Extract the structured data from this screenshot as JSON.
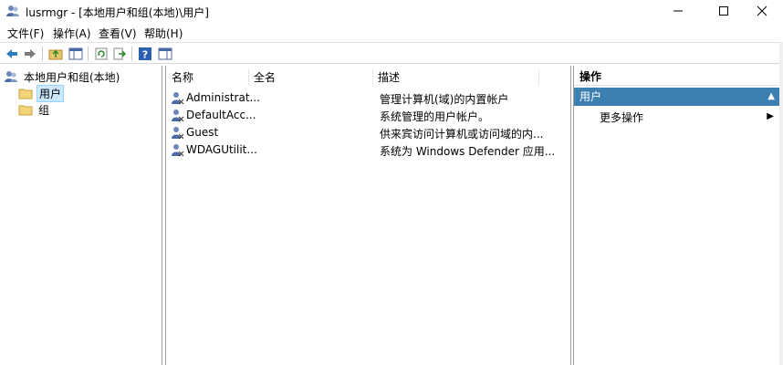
{
  "window": {
    "title": "lusrmgr - [本地用户和组(本地)\\用户]",
    "app_icon": "users-icon"
  },
  "menu": [
    {
      "label": "文件(F)"
    },
    {
      "label": "操作(A)"
    },
    {
      "label": "查看(V)"
    },
    {
      "label": "帮助(H)"
    }
  ],
  "toolbar": {
    "icons": [
      "back-icon",
      "forward-icon",
      "up-folder-icon",
      "show-hide-tree-icon",
      "refresh-icon",
      "export-list-icon",
      "help-icon",
      "show-hide-action-pane-icon"
    ]
  },
  "tree": {
    "root": "本地用户和组(本地)",
    "items": [
      {
        "label": "用户",
        "selected": true
      },
      {
        "label": "组",
        "selected": false
      }
    ]
  },
  "list": {
    "columns": [
      "名称",
      "全名",
      "描述"
    ],
    "rows": [
      {
        "name": "Administrat...",
        "fullname": "",
        "desc": "管理计算机(域)的内置帐户"
      },
      {
        "name": "DefaultAcc...",
        "fullname": "",
        "desc": "系统管理的用户帐户。"
      },
      {
        "name": "Guest",
        "fullname": "",
        "desc": "供来宾访问计算机或访问域的内..."
      },
      {
        "name": "WDAGUtilit...",
        "fullname": "",
        "desc": "系统为 Windows Defender 应用..."
      }
    ]
  },
  "actions": {
    "header": "操作",
    "section": "用户",
    "items": [
      "更多操作"
    ]
  },
  "colors": {
    "selection_bg": "#cce8ff",
    "section_bg": "#3c7fb1",
    "border": "#a0a0a0"
  }
}
